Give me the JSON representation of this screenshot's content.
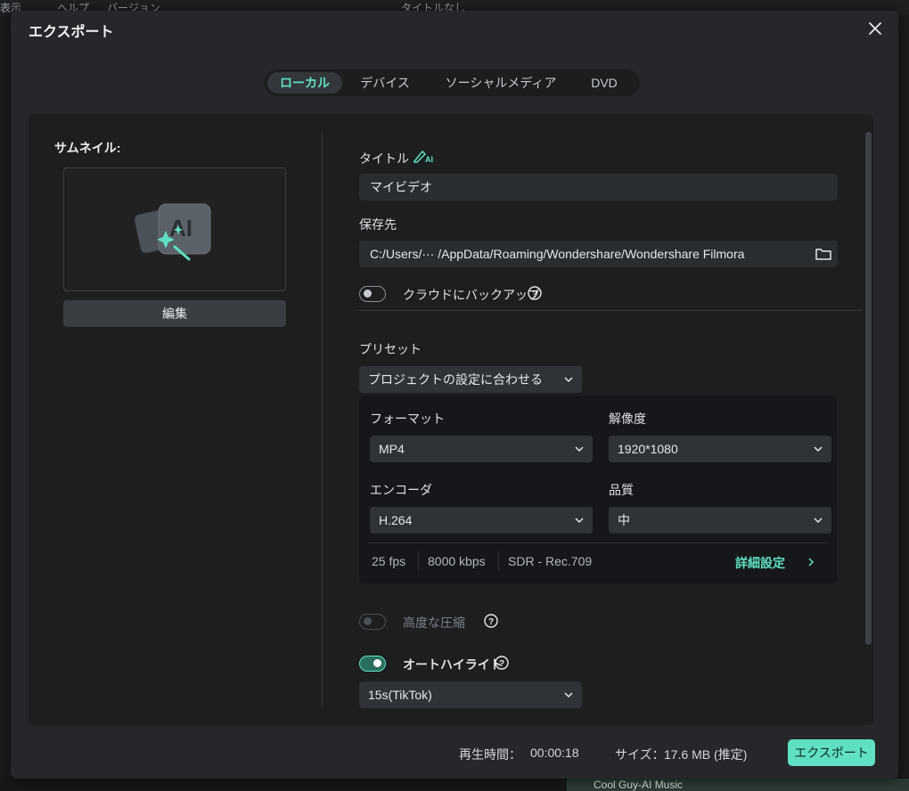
{
  "background": {
    "menu": [
      "表示",
      "ヘルプ",
      "バージョン"
    ],
    "project_title": "タイトルなし",
    "clip_label": "Cool Guy-AI Music"
  },
  "dialog": {
    "title": "エクスポート",
    "tabs": [
      "ローカル",
      "デバイス",
      "ソーシャルメディア",
      "DVD"
    ],
    "active_tab": "ローカル"
  },
  "thumbnail": {
    "label": "サムネイル:",
    "edit_label": "編集",
    "icon": "ai-image-icon"
  },
  "form": {
    "title_label": "タイトル",
    "title_value": "マイビデオ",
    "save_label": "保存先",
    "save_path": "C:/Users/··· /AppData/Roaming/Wondershare/Wondershare Filmora",
    "cloud_label": "クラウドにバックアップ",
    "cloud_on": false,
    "preset_label": "プリセット",
    "preset_value": "プロジェクトの設定に合わせる",
    "format_label": "フォーマット",
    "format_value": "MP4",
    "resolution_label": "解像度",
    "resolution_value": "1920*1080",
    "encoder_label": "エンコーダ",
    "encoder_value": "H.264",
    "quality_label": "品質",
    "quality_value": "中",
    "fps": "25 fps",
    "bitrate": "8000 kbps",
    "color_space": "SDR - Rec.709",
    "advanced_label": "詳細設定",
    "compress_label": "高度な圧縮",
    "compress_enabled": false,
    "autohighlight_label": "オートハイライト",
    "autohighlight_on": true,
    "highlight_value": "15s(TikTok)"
  },
  "footer": {
    "duration_label": "再生時間：",
    "duration_value": "00:00:18",
    "size_label": "サイズ：",
    "size_value": "17.6 MB (推定)",
    "export_label": "エクスポート"
  },
  "colors": {
    "accent": "#5fe0c3",
    "dialog_bg": "#25272a",
    "panel_bg": "#1c1e20"
  }
}
